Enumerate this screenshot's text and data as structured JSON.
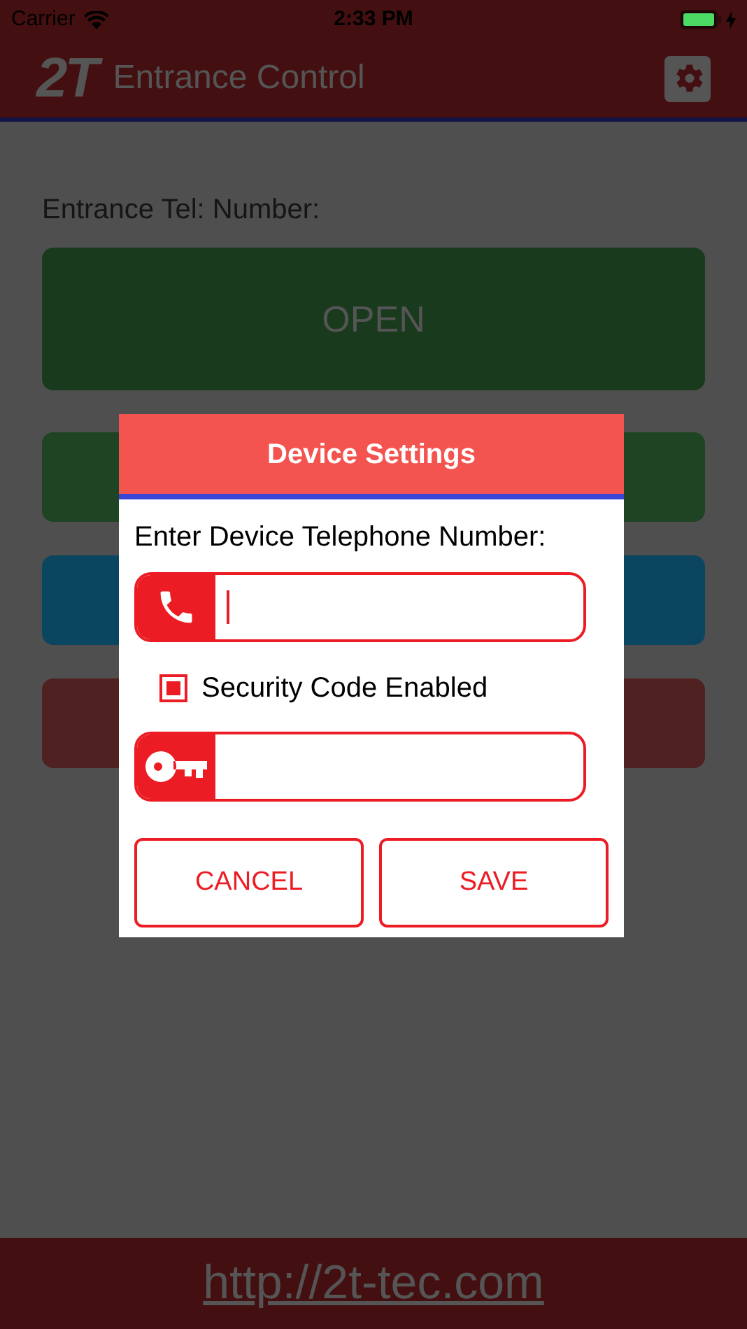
{
  "status_bar": {
    "carrier": "Carrier",
    "time": "2:33 PM"
  },
  "header": {
    "logo": "2T",
    "title": "Entrance Control"
  },
  "main": {
    "label": "Entrance Tel: Number:",
    "open_button": "OPEN",
    "hidden_buttons": [
      {
        "color": "#1e4424"
      },
      {
        "color": "#0b4660"
      },
      {
        "color": "#4f2121"
      }
    ]
  },
  "dialog": {
    "title": "Device Settings",
    "prompt": "Enter Device Telephone Number:",
    "phone_field": {
      "focused": true
    },
    "security": {
      "label": "Security Code Enabled",
      "checked": true
    },
    "code_field": {
      "focused": false
    },
    "buttons": [
      "CANCEL",
      "SAVE"
    ]
  },
  "footer": {
    "link": "http://2t-tec.com"
  }
}
